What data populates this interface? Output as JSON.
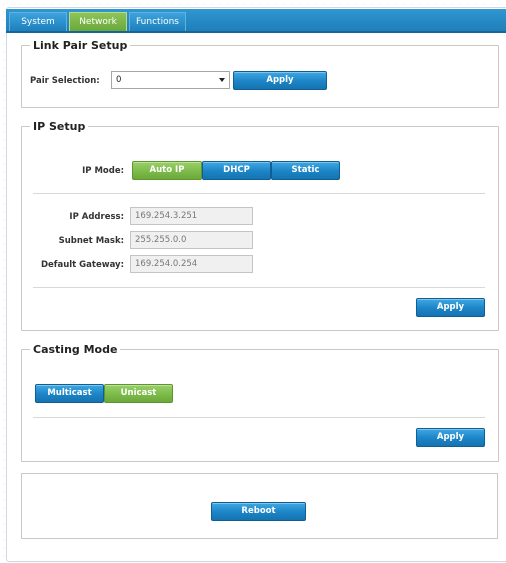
{
  "tabs": [
    {
      "label": "System",
      "active": false
    },
    {
      "label": "Network",
      "active": true
    },
    {
      "label": "Functions",
      "active": false
    }
  ],
  "link_pair": {
    "legend": "Link Pair Setup",
    "pair_label": "Pair Selection:",
    "pair_value": "0",
    "apply_label": "Apply"
  },
  "ip_setup": {
    "legend": "IP Setup",
    "mode_label": "IP Mode:",
    "modes": [
      "Auto IP",
      "DHCP",
      "Static"
    ],
    "selected_mode": "Auto IP",
    "ip_label": "IP Address:",
    "ip_value": "169.254.3.251",
    "mask_label": "Subnet Mask:",
    "mask_value": "255.255.0.0",
    "gateway_label": "Default Gateway:",
    "gateway_value": "169.254.0.254",
    "apply_label": "Apply"
  },
  "casting": {
    "legend": "Casting Mode",
    "modes": [
      "Multicast",
      "Unicast"
    ],
    "selected_mode": "Unicast",
    "apply_label": "Apply"
  },
  "reboot": {
    "label": "Reboot"
  },
  "colors": {
    "tab_bar": "#1f7fb9",
    "button_blue": "#1c84c6",
    "button_green": "#7cbb4a"
  }
}
